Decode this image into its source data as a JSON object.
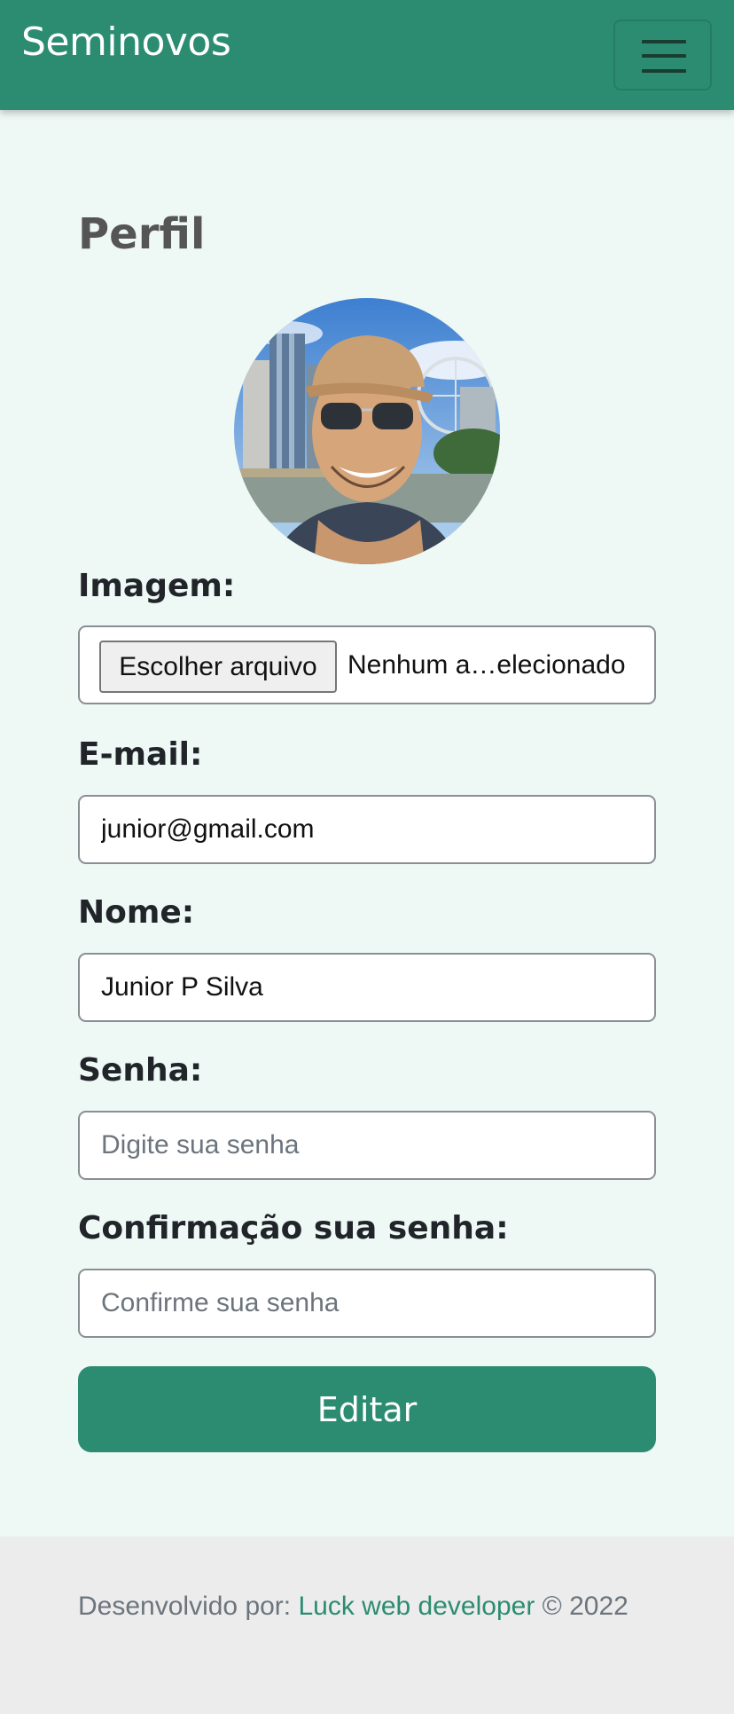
{
  "navbar": {
    "brand": "Seminovos",
    "toggle_icon": "hamburger-menu-icon"
  },
  "page": {
    "title": "Perfil"
  },
  "avatar": {
    "alt": "profile photo"
  },
  "form": {
    "image_label": "Imagem:",
    "file_button": "Escolher arquivo",
    "file_status": "Nenhum a…elecionado",
    "email_label": "E-mail:",
    "email_value": "junior@gmail.com",
    "name_label": "Nome:",
    "name_value": "Junior P Silva",
    "password_label": "Senha:",
    "password_placeholder": "Digite sua senha",
    "confirm_label": "Confirmação sua senha:",
    "confirm_placeholder": "Confirme sua senha",
    "submit_label": "Editar"
  },
  "footer": {
    "prefix": "Desenvolvido por: ",
    "link": "Luck web developer",
    "suffix": " © 2022"
  },
  "colors": {
    "primary": "#2c8c71",
    "background": "#eef8f5",
    "footer_bg": "#ececec"
  }
}
